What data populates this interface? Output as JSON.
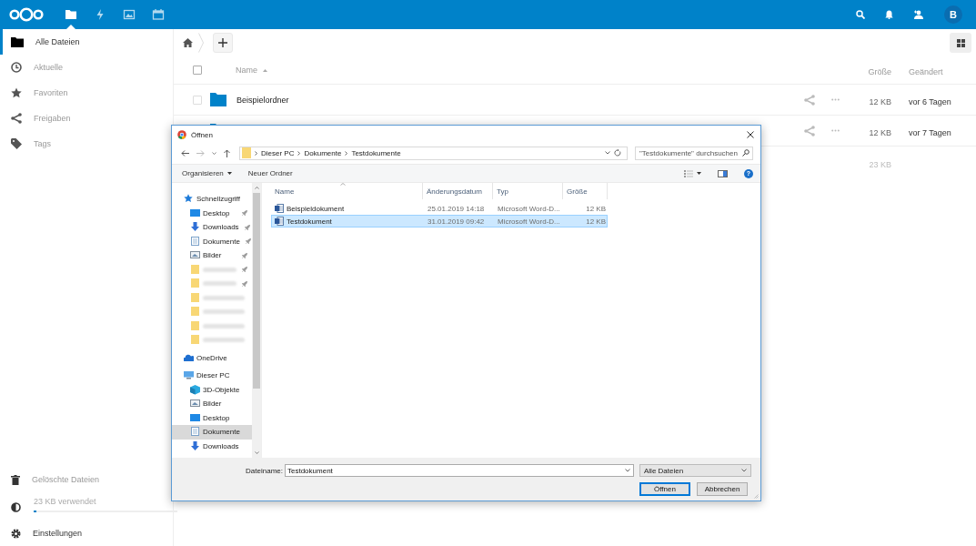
{
  "header": {
    "apps": [
      {
        "kind": "files",
        "selected": true
      },
      {
        "kind": "activity",
        "selected": false
      },
      {
        "kind": "photos",
        "selected": false
      },
      {
        "kind": "calendar",
        "selected": false
      }
    ],
    "avatar": "B"
  },
  "sidebar": {
    "items": [
      {
        "kind": "folder",
        "label": "Alle Dateien",
        "selected": true
      },
      {
        "kind": "clock",
        "label": "Aktuelle",
        "selected": false
      },
      {
        "kind": "star",
        "label": "Favoriten",
        "selected": false
      },
      {
        "kind": "share",
        "label": "Freigaben",
        "selected": false
      },
      {
        "kind": "tag",
        "label": "Tags",
        "selected": false
      }
    ],
    "trash": "Gelöschte Dateien",
    "quota": {
      "label": "23 KB verwendet",
      "level": 0.02
    },
    "settings": "Einstellungen"
  },
  "files": {
    "columns": {
      "name": "Name",
      "size": "Größe",
      "modified": "Geändert"
    },
    "all_checked": false,
    "rows": [
      {
        "name": "Beispielordner",
        "size": "12 KB",
        "modified": "vor 6 Tagen",
        "checked": false
      },
      {
        "size": "12 KB",
        "modified": "vor 7 Tagen"
      }
    ],
    "summary": {
      "size": "23 KB"
    }
  },
  "dialog": {
    "title": "Öffnen",
    "path": [
      "Dieser PC",
      "Dokumente",
      "Testdokumente"
    ],
    "search_placeholder": "\"Testdokumente\" durchsuchen",
    "commands": [
      {
        "label": "Organisieren",
        "kind": "menu"
      },
      {
        "label": "Neuer Ordner",
        "kind": "plain"
      }
    ],
    "help": "?",
    "nav": [
      {
        "kind": "quick",
        "label": "Schnellzugriff",
        "children": [
          {
            "kind": "desktop",
            "label": "Desktop",
            "pinned": true
          },
          {
            "kind": "download",
            "label": "Downloads",
            "pinned": true
          },
          {
            "kind": "document",
            "label": "Dokumente",
            "pinned": true
          },
          {
            "kind": "pictures",
            "label": "Bilder",
            "pinned": true
          },
          {
            "kind": "blurred",
            "pinned": true
          },
          {
            "kind": "blurred",
            "pinned": true
          },
          {
            "kind": "blurred",
            "pinned": false
          },
          {
            "kind": "blurred",
            "pinned": false
          },
          {
            "kind": "blurred",
            "pinned": false
          },
          {
            "kind": "blurred",
            "pinned": false
          }
        ]
      },
      {
        "kind": "cloud",
        "label": "OneDrive"
      },
      {
        "kind": "pc",
        "label": "Dieser PC",
        "children": [
          {
            "kind": "cube",
            "label": "3D-Objekte",
            "selected": false
          },
          {
            "kind": "pictures",
            "label": "Bilder",
            "selected": false
          },
          {
            "kind": "desktop",
            "label": "Desktop",
            "selected": false
          },
          {
            "kind": "document",
            "label": "Dokumente",
            "selected": true
          },
          {
            "kind": "download",
            "label": "Downloads",
            "selected": false
          }
        ]
      }
    ],
    "columns": [
      "Name",
      "Änderungsdatum",
      "Typ",
      "Größe"
    ],
    "rows": [
      {
        "name": "Beispieldokument",
        "date": "25.01.2019 14:18",
        "type": "Microsoft Word-D...",
        "size": "12 KB",
        "selected": false
      },
      {
        "name": "Testdokument",
        "date": "31.01.2019 09:42",
        "type": "Microsoft Word-D...",
        "size": "12 KB",
        "selected": true
      }
    ],
    "filename_label": "Dateiname:",
    "filename": "Testdokument",
    "filter": "Alle Dateien",
    "buttons": [
      {
        "label": "Öffnen",
        "default": true
      },
      {
        "label": "Abbrechen",
        "default": false
      }
    ]
  }
}
